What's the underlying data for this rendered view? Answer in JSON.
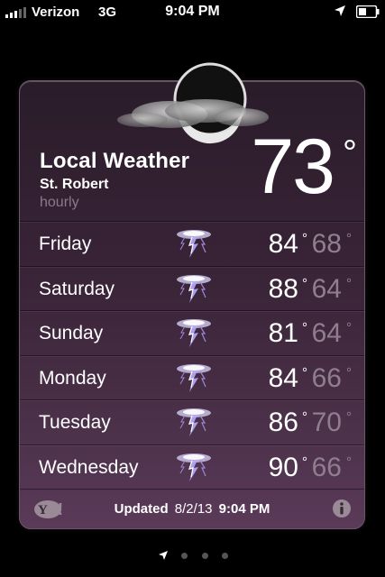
{
  "status_bar": {
    "carrier": "Verizon",
    "network": "3G",
    "time": "9:04 PM"
  },
  "widget": {
    "title": "Local Weather",
    "location": "St. Robert",
    "mode": "hourly",
    "current_temp": "73",
    "current_deg": "°",
    "forecast": [
      {
        "day": "Friday",
        "hi": "84",
        "lo": "68",
        "icon": "thunderstorm-icon"
      },
      {
        "day": "Saturday",
        "hi": "88",
        "lo": "64",
        "icon": "thunderstorm-icon"
      },
      {
        "day": "Sunday",
        "hi": "81",
        "lo": "64",
        "icon": "thunderstorm-icon"
      },
      {
        "day": "Monday",
        "hi": "84",
        "lo": "66",
        "icon": "thunderstorm-icon"
      },
      {
        "day": "Tuesday",
        "hi": "86",
        "lo": "70",
        "icon": "thunderstorm-icon"
      },
      {
        "day": "Wednesday",
        "hi": "90",
        "lo": "66",
        "icon": "thunderstorm-icon"
      }
    ],
    "deg": "°",
    "footer": {
      "updated_label": "Updated",
      "updated_date": "8/2/13",
      "updated_time": "9:04 PM"
    }
  },
  "pager": {
    "pages": 4,
    "active": 0
  }
}
